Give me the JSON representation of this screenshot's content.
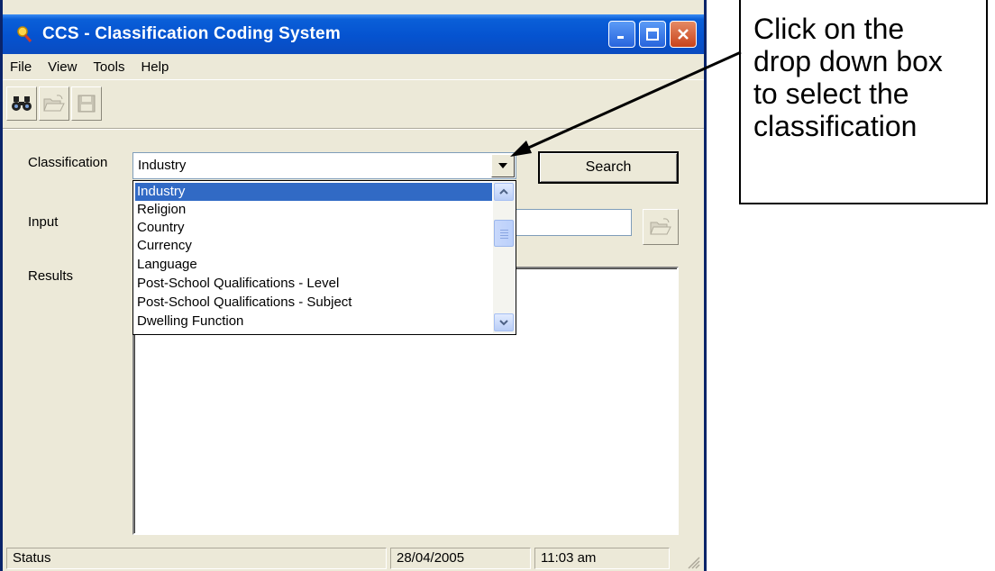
{
  "window": {
    "title": "CCS - Classification Coding System",
    "controls": {
      "minimize": "_",
      "maximize": "□",
      "close": "✕"
    }
  },
  "menu": {
    "file": "File",
    "view": "View",
    "tools": "Tools",
    "help": "Help"
  },
  "toolbar": {
    "buttons": [
      {
        "icon": "binoculars-icon",
        "enabled": true
      },
      {
        "icon": "open-folder-icon",
        "enabled": false
      },
      {
        "icon": "save-icon",
        "enabled": false
      }
    ]
  },
  "form": {
    "classification_label": "Classification",
    "classification_value": "Industry",
    "search_label": "Search",
    "input_label": "Input",
    "input_value": "",
    "results_label": "Results"
  },
  "dropdown": {
    "items": [
      "Industry",
      "Religion",
      "Country",
      "Currency",
      "Language",
      "Post-School Qualifications - Level",
      "Post-School Qualifications - Subject",
      "Dwelling Function"
    ],
    "selected_index": 0
  },
  "status": {
    "text": "Status",
    "date": "28/04/2005",
    "time": "11:03 am"
  },
  "callout": {
    "lines": [
      "Click on the",
      "drop down box",
      "to select the",
      "classification"
    ]
  },
  "colors": {
    "titlebar": "#0553d0",
    "selection": "#316ac5",
    "face": "#ece9d8"
  }
}
